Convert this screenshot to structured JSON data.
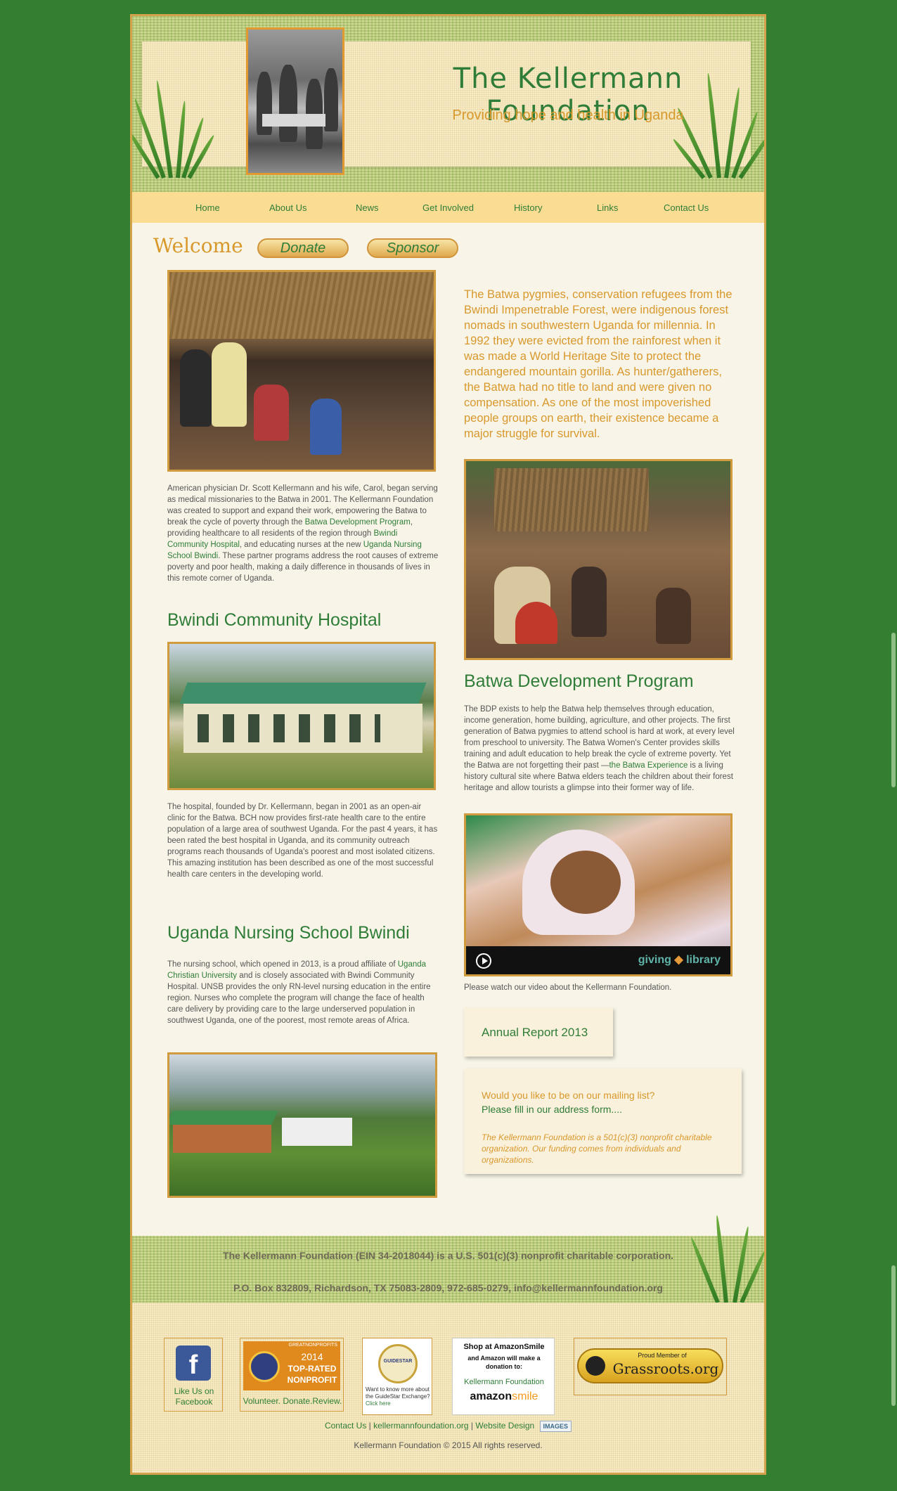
{
  "header": {
    "title": "The Kellermann Foundation",
    "tagline": "Providing hope and health in Uganda"
  },
  "nav": [
    "Home",
    "About Us",
    "News",
    "Get Involved",
    "History",
    "Links",
    "Contact Us"
  ],
  "welcome": {
    "heading": "Welcome",
    "donate_label": "Donate",
    "sponsor_label": "Sponsor"
  },
  "intro": {
    "lead": "The Batwa pygmies, conservation refugees from the Bwindi Impenetrable Forest, were indigenous forest nomads in southwestern Uganda for millennia. In 1992 they were evicted from the rainforest when it was made a World Heritage Site to protect the endangered mountain gorilla. As hunter/gatherers, the Batwa had no title to land and were given no compensation. As one of the most impoverished people groups on earth, their existence became a major struggle for survival.",
    "p1_a": "American physician Dr. Scott Kellermann and his wife, Carol, began serving as medical missionaries to the Batwa in 2001. The Kellermann Foundation was created to support and expand their work, empowering the Batwa to break the cycle of poverty through the ",
    "p1_link1": "Batwa Development Program",
    "p1_b": ", providing healthcare to all residents of the region through ",
    "p1_link2": "Bwindi Community Hospital",
    "p1_c": ", and educating nurses at the new ",
    "p1_link3": "Uganda Nursing School Bwindi",
    "p1_d": ". These partner programs address the root causes of extreme poverty and poor health, making a daily difference in thousands of lives in this remote corner of Uganda."
  },
  "hospital": {
    "heading": "Bwindi Community Hospital",
    "text": "The hospital, founded by Dr. Kellermann, began in 2001 as an open-air clinic for the Batwa. BCH now provides first-rate health care to the entire population of a large area of southwest Uganda. For the past 4 years, it has been rated the best hospital in Uganda, and its community outreach programs reach thousands of Uganda's poorest and most isolated citizens. This amazing institution has been described as one of the most successful health care centers in the developing world."
  },
  "nursing": {
    "heading": "Uganda Nursing School Bwindi",
    "text_a": "The nursing school, which opened in 2013, is a proud affiliate of ",
    "link": "Uganda Christian University",
    "text_b": " and is closely associated with Bwindi Community Hospital. UNSB provides the only RN-level nursing education in the entire region. Nurses who complete the program will change the face of health care delivery by providing care to the large underserved population in southwest Uganda, one of the poorest, most remote areas of Africa."
  },
  "bdp": {
    "heading": "Batwa Development Program",
    "text_a": "The BDP exists to help the Batwa help themselves through education, income generation, home building, agriculture, and other projects. The first generation of Batwa pygmies to attend school is hard at work, at every level from preschool to university. The Batwa Women's Center provides skills training and adult education to help break the cycle of extreme poverty. Yet the Batwa are not forgetting their past —",
    "link": "the Batwa Experience",
    "text_b": " is a living history cultural site where Batwa elders teach the children about their forest heritage and allow tourists a glimpse into their former way of life."
  },
  "video": {
    "brand_left": "giving",
    "brand_right": "library",
    "caption": "Please watch our video about the Kellermann Foundation."
  },
  "annual_report": "Annual Report 2013",
  "mailing": {
    "line1": "Would you like to be on our mailing list?",
    "line2": "Please fill in our address form....",
    "note": "The Kellermann Foundation is a 501(c)(3) nonprofit charitable organization. Our funding comes from individuals and organizations."
  },
  "footer": {
    "line1": "The Kellermann Foundation (EIN 34-2018044) is a U.S. 501(c)(3) nonprofit charitable corporation.",
    "line2": "P.O. Box 832809, Richardson, TX 75083-2809, 972-685-0279, info@kellermannfoundation.org",
    "badges": {
      "facebook": "Like Us on Facebook",
      "gn_top": "GREATNONPROFITS",
      "gn_year": "2014",
      "gn_rated": "TOP-RATED",
      "gn_np": "NONPROFIT",
      "gn_sub": "Volunteer. Donate.Review.",
      "guidestar_logo": "GUIDESTAR",
      "guidestar_text": "Want to know more about the GuideStar Exchange?",
      "guidestar_link": "Click here",
      "amazon_l1": "Shop at AmazonSmile",
      "amazon_l2": "and Amazon will make a donation to:",
      "amazon_org": "Kellermann Foundation",
      "amazon_logo_a": "amazon",
      "amazon_logo_b": "smile",
      "grassroots_small": "Proud Member of",
      "grassroots_big": "Grassroots.org"
    },
    "links": [
      "Contact Us",
      "kellermannfoundation.org",
      "Website Design"
    ],
    "images_badge": "IMAGES",
    "copyright": "Kellermann Foundation © 2015 All rights reserved."
  },
  "colors": {
    "background": "#337f32",
    "accent_green": "#2f7d38",
    "accent_gold": "#d8982c",
    "paper": "#f8f5e8"
  }
}
